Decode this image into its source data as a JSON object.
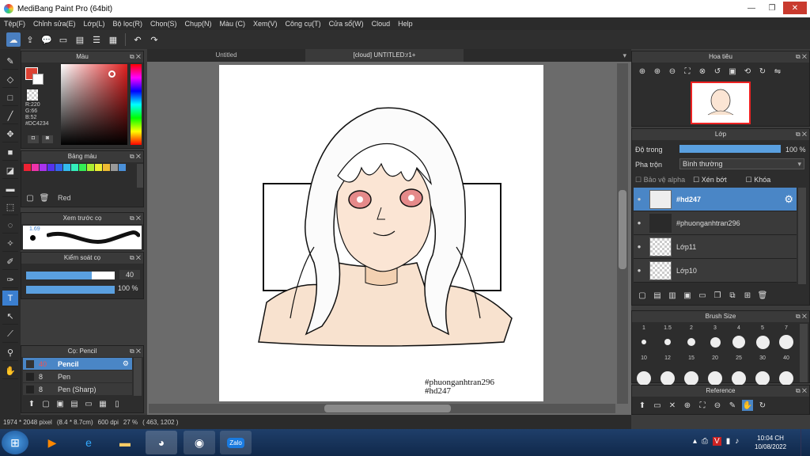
{
  "window": {
    "title": "MediBang Paint Pro (64bit)",
    "minimize": "—",
    "maximize": "❐",
    "close": "✕"
  },
  "menu": [
    "Tệp(F)",
    "Chỉnh sửa(E)",
    "Lớp(L)",
    "Bộ lọc(R)",
    "Chọn(S)",
    "Chụp(N)",
    "Màu (C)",
    "Xem(V)",
    "Công cụ(T)",
    "Cửa sổ(W)",
    "Cloud",
    "Help"
  ],
  "doc_tabs": [
    "Untitled",
    "[cloud] UNTITLED:r1+"
  ],
  "panels": {
    "color": {
      "title": "Màu",
      "r": "R:220",
      "g": "G:66",
      "b": "B:52",
      "hex": "#DC4234",
      "primary_color": "#DC4234"
    },
    "palette": {
      "title": "Bảng màu",
      "selected_name": "Red"
    },
    "brush_preview": {
      "title": "Xem trước cọ",
      "size": "1.69"
    },
    "brush_control": {
      "title": "Kiểm soát cọ",
      "size_value": "40",
      "opacity_value": "100 %",
      "size_fraction": 0.74,
      "opacity_fraction": 1.0
    },
    "brush": {
      "title": "Cọ: Pencil",
      "items": [
        {
          "size": "40",
          "name": "Pencil"
        },
        {
          "size": "8",
          "name": "Pen"
        },
        {
          "size": "8",
          "name": "Pen (Sharp)"
        }
      ]
    },
    "navigator": {
      "title": "Hoa tiêu"
    },
    "layer": {
      "title": "Lớp",
      "opacity_label": "Độ trong",
      "opacity_value": "100 %",
      "opacity_fraction": 1.0,
      "blend_label": "Pha trộn",
      "blend_value": "Bình thường",
      "alpha_label": "Bảo vệ alpha",
      "clip_label": "Xén bớt",
      "lock_label": "Khóa",
      "layers": [
        "#hd247",
        "#phuonganhtran296",
        "Lớp11",
        "Lớp10"
      ]
    },
    "brush_size": {
      "title": "Brush Size",
      "row1": [
        "1",
        "1.5",
        "2",
        "3",
        "4",
        "5",
        "7"
      ],
      "row2": [
        "10",
        "12",
        "15",
        "20",
        "25",
        "30",
        "40"
      ]
    },
    "reference": {
      "title": "Reference"
    }
  },
  "canvas": {
    "signature_line1": "#phuonganhtran296",
    "signature_line2": "#hd247"
  },
  "status": {
    "size": "1974 * 2048 pixel",
    "cm": "(8.4 * 8.7cm)",
    "dpi": "600 dpi",
    "zoom": "27 %",
    "coords": "( 463, 1202 )"
  },
  "taskbar": {
    "time": "10:04 CH",
    "date": "10/08/2022"
  }
}
